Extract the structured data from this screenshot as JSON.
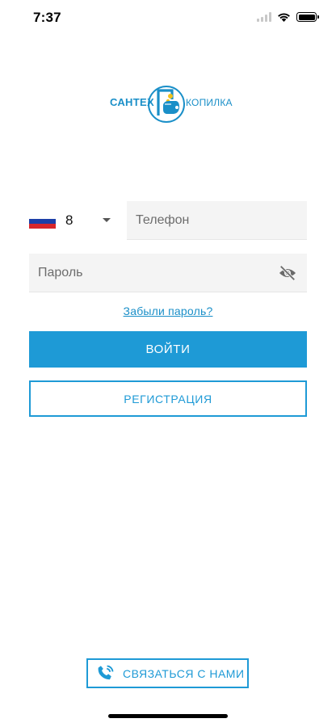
{
  "status_bar": {
    "time": "7:37"
  },
  "logo": {
    "left_text": "САНТЕХ",
    "right_text": "КОПИЛКА"
  },
  "phone": {
    "country_code": "8",
    "placeholder": "Телефон",
    "value": "",
    "flag_colors": [
      "#ffffff",
      "#1c3fa8",
      "#d7262b"
    ]
  },
  "password": {
    "placeholder": "Пароль",
    "value": ""
  },
  "forgot_link": "Забыли пароль?",
  "buttons": {
    "login": "ВОЙТИ",
    "register": "РЕГИСТРАЦИЯ",
    "contact": "СВЯЗАТЬСЯ С НАМИ"
  },
  "icons": {
    "visibility": "eye-off-icon",
    "contact": "phone-call-icon",
    "dropdown": "chevron-down-icon"
  },
  "colors": {
    "accent": "#1e9ad6",
    "input_bg": "#f4f4f4"
  }
}
